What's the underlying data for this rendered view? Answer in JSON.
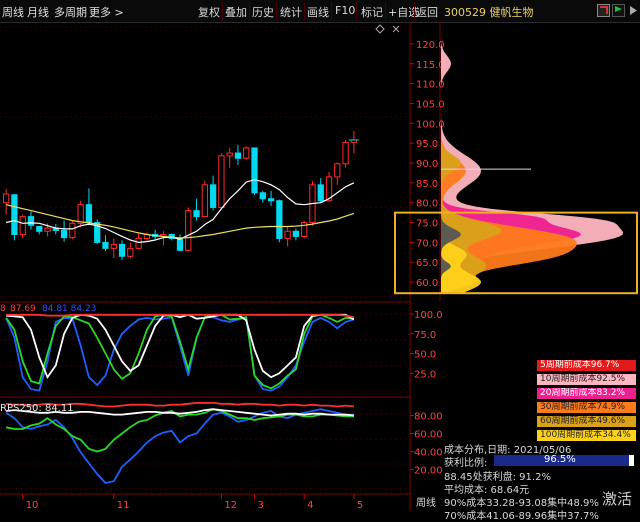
{
  "toolbar": {
    "period_weekly": "周线",
    "period_monthly": "月线",
    "multi_period": "多周期",
    "more": "更多 >",
    "restore_rights": "复权",
    "overlay": "叠加",
    "history": "历史",
    "stats": "统计",
    "draw_line": "画线",
    "f10": "F10",
    "mark": "标记",
    "add_watchlist": "+自选",
    "back": "返回",
    "stock": "300529 健帆生物"
  },
  "price_axis": [
    "120.0",
    "115.0",
    "110.0",
    "105.0",
    "100.0",
    "95.0",
    "90.0",
    "85.0",
    "80.0",
    "75.0",
    "70.0",
    "65.0",
    "60.0"
  ],
  "ind1": {
    "label_left": "8",
    "label_value": "87.69",
    "label_value2": "84.81 84.23",
    "axis": [
      "100.0",
      "75.0",
      "50.0",
      "25.0"
    ]
  },
  "ind2": {
    "label": "RPS250: 84.11",
    "axis": [
      "80.00",
      "60.00",
      "40.00",
      "20.00"
    ]
  },
  "time_axis": [
    "10",
    "11",
    "12",
    "3",
    "4",
    "5"
  ],
  "period_label": "周线",
  "legend": [
    {
      "text": "5周期前成本96.7%",
      "bg": "#e31a1a",
      "fg": "#ffffff"
    },
    {
      "text": "10周期前成本92.5%",
      "bg": "#ffb6c1",
      "fg": "#222222"
    },
    {
      "text": "20周期前成本83.2%",
      "bg": "#ee1f8f",
      "fg": "#ffffff"
    },
    {
      "text": "30周期前成本74.9%",
      "bg": "#ff7a1a",
      "fg": "#222222"
    },
    {
      "text": "60周期前成本49.6%",
      "bg": "#d9a21a",
      "fg": "#222222"
    },
    {
      "text": "100周期前成本34.4%",
      "bg": "#ffd21a",
      "fg": "#222222"
    }
  ],
  "cost_info": {
    "title": "成本分布,日期:",
    "date": "2021/05/06",
    "profit_label": "获利比例:",
    "profit_value": "96.5%",
    "profit_line": "88.45处获利盘: 91.2%",
    "avg_cost": "平均成本: 68.64元",
    "cost90": "90%成本33.28-93.08集中48.9%",
    "cost70": "70%成本41.06-89.96集中37.7%"
  },
  "watermark": "激活",
  "colors": {
    "up": "#ff2a2a",
    "down": "#00d8f0",
    "ma1": "#ffffff",
    "ma2": "#e8e060",
    "k": "#ffffff",
    "d": "#2ad82a",
    "j": "#2060ff",
    "rps_top": "#ff3030"
  },
  "chart_data": [
    {
      "type": "candlestick",
      "period": "weekly",
      "ylim": [
        57,
        123
      ],
      "candles": [
        [
          80.0,
          83.5,
          77.0,
          82.2
        ],
        [
          82.0,
          82.2,
          70.5,
          72.0
        ],
        [
          72.0,
          77.0,
          71.0,
          76.5
        ],
        [
          76.5,
          77.8,
          73.2,
          74.3
        ],
        [
          74.0,
          74.0,
          72.0,
          72.8
        ],
        [
          72.8,
          74.8,
          71.5,
          73.6
        ],
        [
          73.6,
          74.6,
          72.0,
          73.0
        ],
        [
          73.0,
          75.5,
          70.2,
          71.2
        ],
        [
          71.2,
          75.5,
          70.8,
          74.8
        ],
        [
          74.8,
          80.5,
          73.8,
          79.5
        ],
        [
          79.5,
          83.6,
          74.3,
          75.0
        ],
        [
          75.0,
          75.8,
          69.6,
          70.0
        ],
        [
          70.0,
          71.8,
          67.8,
          68.5
        ],
        [
          68.5,
          71.0,
          66.0,
          69.5
        ],
        [
          69.5,
          70.5,
          65.6,
          66.5
        ],
        [
          66.5,
          70.0,
          66.0,
          68.5
        ],
        [
          68.5,
          72.2,
          68.3,
          71.0
        ],
        [
          71.0,
          72.5,
          70.2,
          72.0
        ],
        [
          72.0,
          73.2,
          70.8,
          71.5
        ],
        [
          71.5,
          72.8,
          69.2,
          72.0
        ],
        [
          72.0,
          72.2,
          70.5,
          71.0
        ],
        [
          71.0,
          72.0,
          67.8,
          68.0
        ],
        [
          68.0,
          78.8,
          67.8,
          78.0
        ],
        [
          78.0,
          81.0,
          75.5,
          76.5
        ],
        [
          76.5,
          85.5,
          76.3,
          84.5
        ],
        [
          84.5,
          86.8,
          78.0,
          78.8
        ],
        [
          78.8,
          92.5,
          78.5,
          91.8
        ],
        [
          91.8,
          93.8,
          88.8,
          92.5
        ],
        [
          92.5,
          94.5,
          89.5,
          91.2
        ],
        [
          91.2,
          94.2,
          90.8,
          93.8
        ],
        [
          93.8,
          93.8,
          82.0,
          82.5
        ],
        [
          82.5,
          83.0,
          80.0,
          81.0
        ],
        [
          81.0,
          83.0,
          79.2,
          80.5
        ],
        [
          80.5,
          80.8,
          70.0,
          71.0
        ],
        [
          71.0,
          74.0,
          69.0,
          72.8
        ],
        [
          72.8,
          73.5,
          70.5,
          71.5
        ],
        [
          71.5,
          75.5,
          71.0,
          75.0
        ],
        [
          75.0,
          85.5,
          74.2,
          84.5
        ],
        [
          84.5,
          86.2,
          80.0,
          80.5
        ],
        [
          80.5,
          87.8,
          80.2,
          86.5
        ],
        [
          86.5,
          90.2,
          84.5,
          89.8
        ],
        [
          89.8,
          95.8,
          88.8,
          95.2
        ],
        [
          95.2,
          98.0,
          92.5,
          95.8
        ]
      ],
      "ma_white": [
        75.0,
        75.5,
        74.8,
        74.9,
        74.8,
        74.2,
        73.6,
        73.4,
        73.4,
        74.2,
        74.6,
        74.2,
        73.5,
        72.5,
        71.5,
        70.6,
        70.0,
        70.2,
        70.6,
        71.2,
        71.3,
        70.8,
        71.8,
        72.8,
        74.5,
        75.8,
        78.5,
        81.0,
        83.0,
        85.2,
        85.8,
        85.3,
        84.5,
        83.3,
        81.3,
        79.7,
        79.5,
        79.8,
        80.0,
        81.0,
        82.5,
        84.0,
        85.0
      ],
      "ma_yellow": [
        79.5,
        79.0,
        78.5,
        78.0,
        77.5,
        77.0,
        76.5,
        76.0,
        75.5,
        75.2,
        74.9,
        74.6,
        74.3,
        73.9,
        73.4,
        72.9,
        72.4,
        72.0,
        71.7,
        71.5,
        71.3,
        71.1,
        71.2,
        71.4,
        71.7,
        72.0,
        72.4,
        72.8,
        73.2,
        73.6,
        73.8,
        73.9,
        74.0,
        74.0,
        74.0,
        74.1,
        74.3,
        74.6,
        75.0,
        75.4,
        75.9,
        76.6,
        77.3
      ]
    },
    {
      "type": "line",
      "name": "ind1",
      "ylim": [
        0,
        100
      ],
      "series": [
        {
          "name": "red",
          "values": [
            99,
            99,
            99,
            99,
            99,
            98,
            98,
            98,
            99,
            99,
            99,
            99,
            99,
            99,
            99,
            99,
            99,
            99,
            99,
            99,
            99,
            99,
            99,
            99,
            99,
            99,
            99,
            99,
            99,
            99,
            99,
            99,
            99,
            99,
            99,
            99,
            99,
            99,
            99,
            99,
            99,
            98,
            96
          ]
        },
        {
          "name": "white",
          "values": [
            98,
            97,
            96,
            80,
            45,
            20,
            35,
            75,
            95,
            99,
            98,
            94,
            80,
            60,
            40,
            28,
            35,
            60,
            85,
            98,
            99,
            96,
            99,
            94,
            95,
            97,
            99,
            99,
            99,
            92,
            55,
            28,
            20,
            25,
            35,
            45,
            85,
            98,
            99,
            99,
            99,
            99,
            93
          ]
        },
        {
          "name": "green",
          "values": [
            95,
            80,
            40,
            15,
            12,
            50,
            85,
            97,
            96,
            92,
            88,
            70,
            50,
            30,
            18,
            25,
            50,
            80,
            97,
            99,
            97,
            65,
            30,
            70,
            96,
            99,
            99,
            93,
            94,
            96,
            22,
            10,
            6,
            12,
            22,
            30,
            75,
            97,
            99,
            95,
            90,
            95,
            94
          ]
        },
        {
          "name": "blue",
          "values": [
            95,
            70,
            20,
            5,
            3,
            40,
            90,
            95,
            94,
            60,
            20,
            10,
            22,
            55,
            75,
            85,
            93,
            95,
            93,
            94,
            96,
            60,
            22,
            70,
            96,
            96,
            92,
            90,
            93,
            95,
            22,
            5,
            3,
            8,
            20,
            35,
            65,
            90,
            95,
            90,
            82,
            90,
            93
          ]
        }
      ]
    },
    {
      "type": "line",
      "name": "RPS250",
      "ylim": [
        0,
        100
      ],
      "series": [
        {
          "name": "red",
          "values": [
            98,
            97,
            97,
            96,
            97,
            98,
            97,
            97,
            98,
            98,
            97,
            96,
            95,
            95,
            96,
            97,
            97,
            97,
            96,
            96,
            97,
            97,
            98,
            99,
            99,
            99,
            98,
            98,
            97,
            98,
            98,
            97,
            97,
            96,
            97,
            97,
            96,
            97,
            96,
            96,
            95,
            96,
            95
          ]
        },
        {
          "name": "white",
          "values": [
            90,
            91,
            90,
            89,
            88,
            88,
            89,
            88,
            88,
            89,
            89,
            88,
            87,
            86,
            86,
            87,
            88,
            89,
            89,
            88,
            88,
            87,
            88,
            89,
            91,
            92,
            91,
            90,
            89,
            88,
            87,
            86,
            85,
            86,
            87,
            87,
            86,
            87,
            87,
            86,
            86,
            86,
            85
          ]
        },
        {
          "name": "green",
          "values": [
            72,
            70,
            70,
            74,
            76,
            82,
            75,
            70,
            62,
            58,
            48,
            45,
            48,
            58,
            65,
            72,
            78,
            80,
            85,
            88,
            90,
            84,
            86,
            86,
            88,
            92,
            90,
            86,
            82,
            82,
            80,
            82,
            83,
            84,
            86,
            86,
            84,
            84,
            86,
            86,
            85,
            84,
            84
          ]
        },
        {
          "name": "blue",
          "values": [
            88,
            82,
            72,
            70,
            73,
            75,
            80,
            72,
            60,
            44,
            32,
            20,
            10,
            12,
            28,
            36,
            45,
            55,
            62,
            66,
            68,
            55,
            62,
            65,
            76,
            86,
            88,
            84,
            78,
            80,
            84,
            88,
            90,
            84,
            82,
            86,
            88,
            90,
            92,
            90,
            88,
            86,
            86
          ]
        }
      ]
    }
  ]
}
